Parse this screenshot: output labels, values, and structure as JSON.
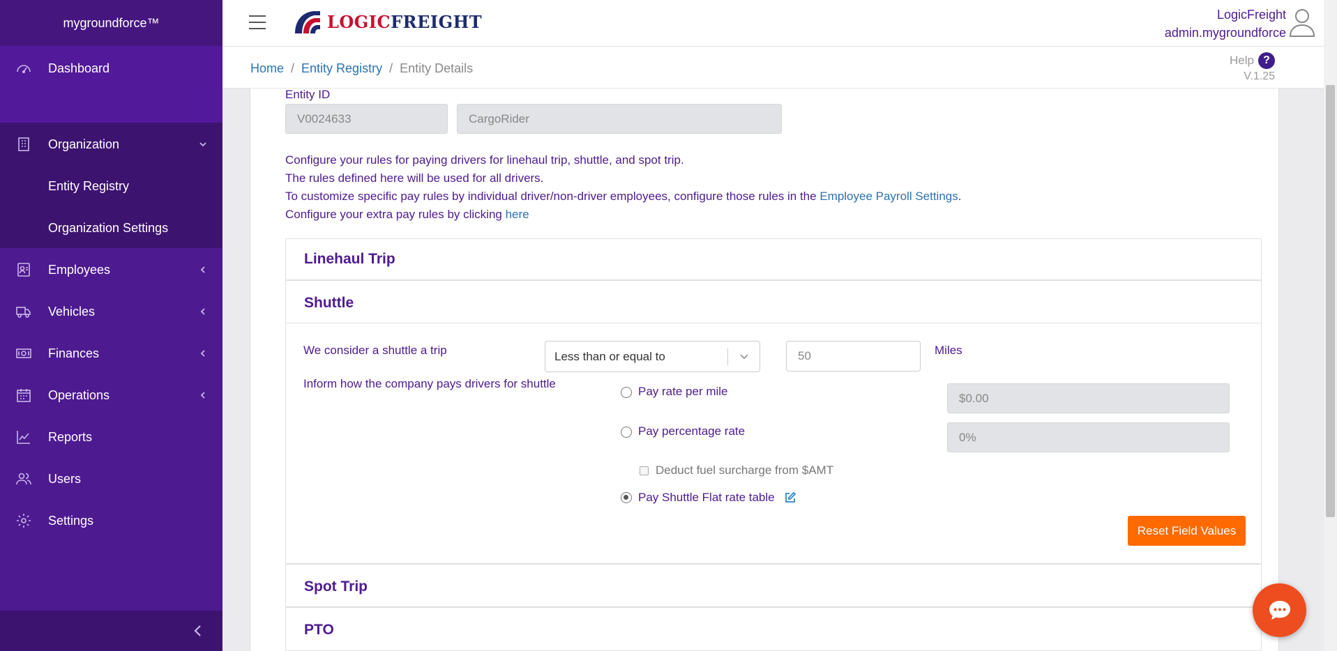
{
  "sidebar": {
    "brand": "mygroundforce™",
    "items": [
      {
        "label": "Dashboard",
        "icon": "gauge-icon"
      },
      {
        "label": "Organization",
        "icon": "building-icon"
      },
      {
        "label": "Employees",
        "icon": "employee-badge-icon"
      },
      {
        "label": "Vehicles",
        "icon": "truck-icon"
      },
      {
        "label": "Finances",
        "icon": "money-icon"
      },
      {
        "label": "Operations",
        "icon": "calendar-icon"
      },
      {
        "label": "Reports",
        "icon": "chart-line-icon"
      },
      {
        "label": "Users",
        "icon": "users-icon"
      },
      {
        "label": "Settings",
        "icon": "gear-icon"
      }
    ],
    "organization_sub": [
      "Entity Registry",
      "Organization Settings"
    ]
  },
  "header": {
    "logo_logic": "LOGIC",
    "logo_freight": "FREIGHT",
    "user_company": "LogicFreight",
    "user_name": "admin.mygroundforce"
  },
  "breadcrumb": {
    "home": "Home",
    "registry": "Entity Registry",
    "current": "Entity Details"
  },
  "help": {
    "label": "Help",
    "icon_text": "?",
    "version": "V.1.25"
  },
  "entity": {
    "id_label": "Entity ID",
    "id_value": "V0024633",
    "name_value": "CargoRider"
  },
  "description": {
    "line1": "Configure your rules for paying drivers for linehaul trip, shuttle, and spot trip.",
    "line2": "The rules defined here will be used for all drivers.",
    "line3_prefix": "To customize specific pay rules by individual driver/non-driver employees, configure those rules in the ",
    "line3_link": "Employee Payroll Settings",
    "line3_suffix": ".",
    "line4_prefix": "Configure your extra pay rules by clicking ",
    "line4_link": "here"
  },
  "sections": {
    "linehaul": "Linehaul Trip",
    "shuttle": "Shuttle",
    "spot": "Spot Trip",
    "pto": "PTO"
  },
  "shuttle": {
    "trip_label": "We consider a shuttle a trip",
    "comparison": "Less than or equal to",
    "distance": "50",
    "unit": "Miles",
    "pay_label": "Inform how the company pays drivers for shuttle",
    "option_per_mile": "Pay rate per mile",
    "per_mile_value": "$0.00",
    "option_percentage": "Pay percentage rate",
    "percentage_value": "0%",
    "deduct_fuel": "Deduct fuel surcharge from $AMT",
    "option_flat": "Pay Shuttle Flat rate table",
    "selected_option": "Pay Shuttle Flat rate table",
    "reset_button": "Reset Field Values"
  },
  "colors": {
    "sidebar": "#4e1a90",
    "accent_text": "#4e1a90",
    "link": "#2b72b5",
    "reset_button": "#ff6a00",
    "chat_button": "#ed4d1f"
  }
}
